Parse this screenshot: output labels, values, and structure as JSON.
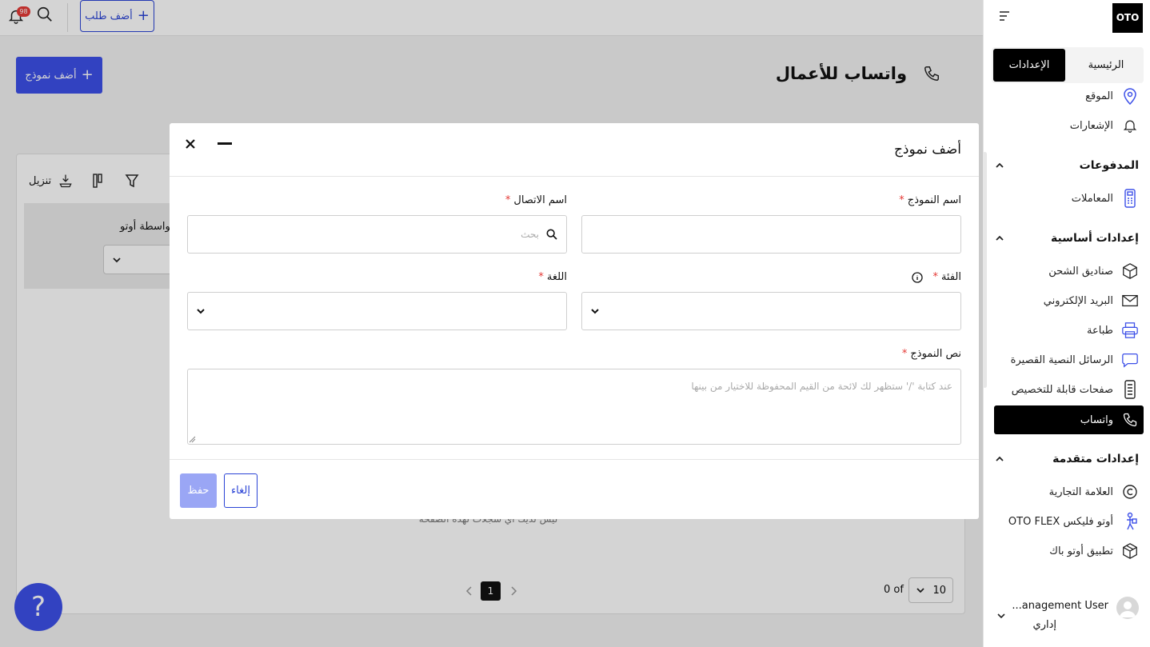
{
  "topbar": {
    "notifications_count": "98",
    "add_order_label": "أضف طلب"
  },
  "page": {
    "title": "واتساب للأعمال",
    "add_template_label": "أضف نموذج"
  },
  "table": {
    "download_label": "تنزيل",
    "filter_label": "بواسطة أوتو",
    "empty_text": "ليس لديك أي سجلات لهذه الصفحة",
    "page_number": "1",
    "rows_info": "0 of",
    "rows_per_page": "10"
  },
  "modal": {
    "title": "أضف نموذج",
    "template_name_label": "اسم النموذج",
    "contact_name_label": "اسم الاتصال",
    "contact_placeholder": "بحث",
    "category_label": "الفئة",
    "language_label": "اللغة",
    "body_label": "نص النموذج",
    "body_placeholder": "عند كتابة '/' ستظهر لك لائحة من القيم المحفوظة للاختيار من بينها",
    "required_mark": "*",
    "save_label": "حفظ",
    "cancel_label": "إلغاء"
  },
  "sidebar": {
    "logo": "OTO",
    "tabs": [
      "الإعدادات",
      "الرئيسية"
    ],
    "items_top": [
      {
        "label": "الموقع",
        "icon": "map-pin-icon"
      },
      {
        "label": "الإشعارات",
        "icon": "bell-icon"
      }
    ],
    "group_payments": "المدفوعات",
    "payments_items": [
      {
        "label": "المعاملات",
        "icon": "card-reader-icon"
      }
    ],
    "group_basic": "إعدادات أساسية",
    "basic_items": [
      {
        "label": "صناديق الشحن",
        "icon": "box-icon"
      },
      {
        "label": "البريد الإلكتروني",
        "icon": "mail-icon"
      },
      {
        "label": "طباعة",
        "icon": "printer-icon"
      },
      {
        "label": "الرسائل النصية القصيرة",
        "icon": "chat-icon"
      },
      {
        "label": "صفحات قابلة للتخصيص",
        "icon": "phone-page-icon"
      },
      {
        "label": "واتساب",
        "icon": "phone-icon"
      }
    ],
    "group_advanced": "إعدادات متقدمة",
    "advanced_items": [
      {
        "label": "العلامة التجارية",
        "icon": "copyright-icon"
      },
      {
        "label": "أوتو فليكس OTO FLEX",
        "icon": "courier-icon"
      },
      {
        "label": "تطبيق أوتو باك",
        "icon": "package-icon"
      }
    ],
    "user_name": "...anagement User",
    "user_role": "إداري"
  },
  "colors": {
    "brand": "#3d50e8",
    "accent_dark": "#000000",
    "required": "#e53935"
  }
}
